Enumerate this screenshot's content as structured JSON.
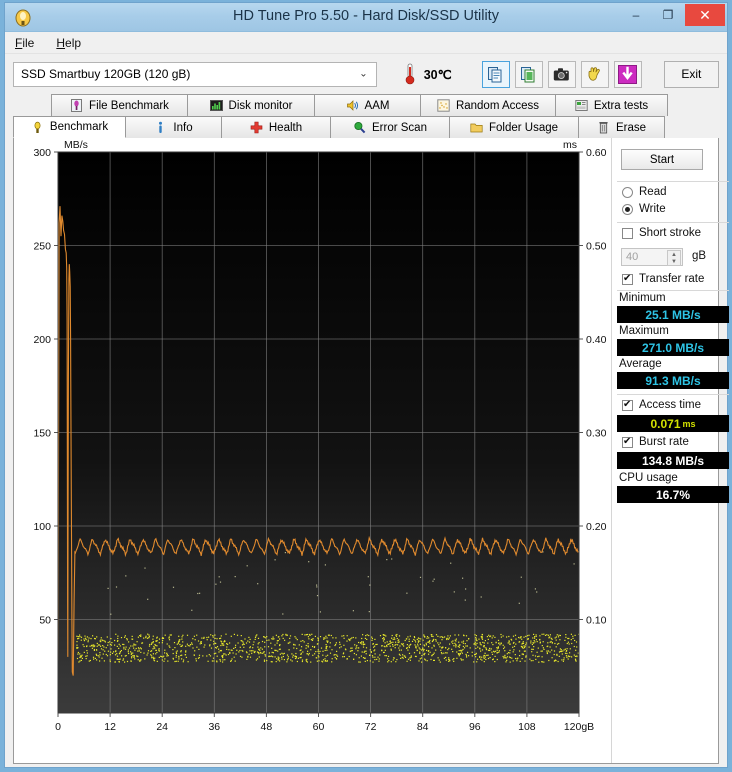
{
  "window": {
    "title": "HD Tune Pro 5.50 - Hard Disk/SSD Utility",
    "app_icon": "hdtune-icon",
    "minimize_label": "–",
    "maximize_label": "❐",
    "close_label": "✕",
    "accent_close": "#e8493f",
    "titlebar_color": "#a8cde9"
  },
  "menu": {
    "items": [
      "File",
      "Help"
    ]
  },
  "toolbar": {
    "drive": "SSD Smartbuy 120GB (120 gB)",
    "drive_placeholder": "Select drive",
    "dropdown_icon": "chevron-down-icon",
    "temperature": "30℃",
    "thermometer_icon": "thermometer-icon",
    "buttons": [
      {
        "name": "copy-icon",
        "selected": true
      },
      {
        "name": "copy-green-icon",
        "selected": false
      },
      {
        "name": "camera-icon",
        "selected": false
      },
      {
        "name": "hand-icon",
        "selected": false
      },
      {
        "name": "download-arrow-icon",
        "selected": false
      }
    ],
    "exit_label": "Exit"
  },
  "tabs": {
    "row1": [
      {
        "label": "File Benchmark",
        "icon": "file-benchmark-icon",
        "active": false
      },
      {
        "label": "Disk monitor",
        "icon": "disk-monitor-icon",
        "active": false
      },
      {
        "label": "AAM",
        "icon": "speaker-icon",
        "active": false
      },
      {
        "label": "Random Access",
        "icon": "random-access-icon",
        "active": false
      },
      {
        "label": "Extra tests",
        "icon": "extra-tests-icon",
        "active": false
      }
    ],
    "row2": [
      {
        "label": "Benchmark",
        "icon": "benchmark-icon",
        "active": true
      },
      {
        "label": "Info",
        "icon": "info-icon",
        "active": false
      },
      {
        "label": "Health",
        "icon": "health-cross-icon",
        "active": false
      },
      {
        "label": "Error Scan",
        "icon": "magnifier-icon",
        "active": false
      },
      {
        "label": "Folder Usage",
        "icon": "folder-icon",
        "active": false
      },
      {
        "label": "Erase",
        "icon": "trash-icon",
        "active": false
      }
    ]
  },
  "sidebar": {
    "start_label": "Start",
    "mode": {
      "read_label": "Read",
      "write_label": "Write",
      "selected": "Write"
    },
    "short_stroke": {
      "label": "Short stroke",
      "checked": false,
      "value": "40",
      "unit": "gB"
    },
    "transfer_rate": {
      "label": "Transfer rate",
      "checked": true
    },
    "minimum": {
      "label": "Minimum",
      "value": "25.1 MB/s",
      "color": "#2ec4e6"
    },
    "maximum": {
      "label": "Maximum",
      "value": "271.0 MB/s",
      "color": "#2ec4e6"
    },
    "average": {
      "label": "Average",
      "value": "91.3 MB/s",
      "color": "#2ec4e6"
    },
    "access_time": {
      "label": "Access time",
      "checked": true,
      "value": "0.071",
      "unit": "ms",
      "color": "#d2e000"
    },
    "burst_rate": {
      "label": "Burst rate",
      "checked": true,
      "value": "134.8 MB/s",
      "color": "#ffffff"
    },
    "cpu_usage": {
      "label": "CPU usage",
      "value": "16.7%",
      "color": "#ffffff"
    }
  },
  "chart_data": {
    "type": "line",
    "title": "",
    "xlabel": "gB",
    "ylabel": "MB/s",
    "y2label": "ms",
    "xlim": [
      0,
      120
    ],
    "ylim": [
      0,
      300
    ],
    "y2lim": [
      0,
      0.6
    ],
    "grid": true,
    "legend": "none",
    "xticks": [
      0,
      12,
      24,
      36,
      48,
      60,
      72,
      84,
      96,
      108,
      120
    ],
    "xticklabels": [
      "0",
      "12",
      "24",
      "36",
      "48",
      "60",
      "72",
      "84",
      "96",
      "108",
      "120gB"
    ],
    "yticks": [
      0,
      50,
      100,
      150,
      200,
      250,
      300
    ],
    "yticklabels": [
      "",
      "50",
      "100",
      "150",
      "200",
      "250",
      "300"
    ],
    "y2ticks": [
      0.1,
      0.2,
      0.3,
      0.4,
      0.5,
      0.6
    ],
    "y2ticklabels": [
      "0.10",
      "0.20",
      "0.30",
      "0.40",
      "0.50",
      "0.60"
    ],
    "plot_bg_top": "#000000",
    "plot_bg_bottom": "#3a3a3a",
    "grid_color": "#808080",
    "series": [
      {
        "name": "Transfer rate",
        "type": "line",
        "axis": "left",
        "color": "#e08a2e",
        "units": "MB/s",
        "points": [
          [
            0.0,
            28
          ],
          [
            0.25,
            262
          ],
          [
            0.45,
            271
          ],
          [
            0.7,
            255
          ],
          [
            0.9,
            266
          ],
          [
            1.1,
            263
          ],
          [
            1.3,
            258
          ],
          [
            1.5,
            256
          ],
          [
            1.7,
            248
          ],
          [
            1.9,
            246
          ],
          [
            2.0,
            238
          ],
          [
            2.1,
            210
          ],
          [
            2.15,
            150
          ],
          [
            2.2,
            60
          ],
          [
            2.25,
            30
          ],
          [
            2.3,
            86
          ],
          [
            2.4,
            180
          ],
          [
            2.5,
            232
          ],
          [
            2.6,
            240
          ],
          [
            2.7,
            236
          ],
          [
            2.8,
            228
          ],
          [
            2.9,
            200
          ],
          [
            3.0,
            150
          ],
          [
            3.1,
            95
          ],
          [
            3.2,
            50
          ],
          [
            3.3,
            22
          ],
          [
            3.5,
            20
          ],
          [
            3.7,
            60
          ],
          [
            3.9,
            86
          ],
          [
            4.1,
            90
          ],
          [
            4.4,
            87
          ],
          [
            4.8,
            93
          ],
          [
            5.2,
            86
          ],
          [
            5.6,
            92
          ],
          [
            6.0,
            85
          ],
          [
            6.5,
            93
          ],
          [
            7.0,
            86
          ],
          [
            7.5,
            92
          ],
          [
            8.0,
            85
          ],
          [
            8.5,
            93
          ],
          [
            9.0,
            86
          ],
          [
            9.5,
            92
          ],
          [
            10.0,
            85
          ],
          [
            10.5,
            93
          ],
          [
            11.0,
            86
          ],
          [
            12.0,
            92
          ],
          [
            13.0,
            86
          ],
          [
            14.0,
            93
          ],
          [
            15.0,
            85
          ],
          [
            16.0,
            92
          ],
          [
            17.0,
            86
          ],
          [
            18.0,
            93
          ],
          [
            19.0,
            85
          ],
          [
            20.0,
            92
          ],
          [
            21.0,
            86
          ],
          [
            22.0,
            93
          ],
          [
            23.0,
            85
          ],
          [
            24.0,
            92
          ],
          [
            25.0,
            86
          ],
          [
            26.0,
            93
          ],
          [
            27.0,
            85
          ],
          [
            28.0,
            92
          ],
          [
            29.0,
            86
          ],
          [
            30.0,
            93
          ],
          [
            31.0,
            85
          ],
          [
            32.0,
            92
          ],
          [
            33.0,
            86
          ],
          [
            34.0,
            93
          ],
          [
            35.0,
            85
          ],
          [
            36.0,
            92
          ],
          [
            38.0,
            86
          ],
          [
            40.0,
            93
          ],
          [
            42.0,
            85
          ],
          [
            44.0,
            92
          ],
          [
            46.0,
            86
          ],
          [
            48.0,
            93
          ],
          [
            50.0,
            85
          ],
          [
            52.0,
            92
          ],
          [
            54.0,
            86
          ],
          [
            56.0,
            93
          ],
          [
            58.0,
            85
          ],
          [
            60.0,
            92
          ],
          [
            62.0,
            86
          ],
          [
            64.0,
            93
          ],
          [
            66.0,
            85
          ],
          [
            68.0,
            92
          ],
          [
            70.0,
            86
          ],
          [
            72.0,
            93
          ],
          [
            74.0,
            85
          ],
          [
            76.0,
            92
          ],
          [
            78.0,
            86
          ],
          [
            80.0,
            93
          ],
          [
            82.0,
            85
          ],
          [
            84.0,
            92
          ],
          [
            86.0,
            86
          ],
          [
            88.0,
            93
          ],
          [
            90.0,
            85
          ],
          [
            92.0,
            92
          ],
          [
            94.0,
            86
          ],
          [
            96.0,
            93
          ],
          [
            98.0,
            85
          ],
          [
            100.0,
            92
          ],
          [
            102.0,
            86
          ],
          [
            104.0,
            93
          ],
          [
            106.0,
            85
          ],
          [
            108.0,
            92
          ],
          [
            110.0,
            86
          ],
          [
            112.0,
            93
          ],
          [
            114.0,
            85
          ],
          [
            116.0,
            92
          ],
          [
            118.0,
            87
          ],
          [
            120.0,
            89
          ]
        ],
        "summary": {
          "minimum_mbs": 25.1,
          "maximum_mbs": 271.0,
          "average_mbs": 91.3,
          "plateau_mean_mbs": 89,
          "plateau_range_mbs": [
            85,
            93
          ]
        }
      },
      {
        "name": "Access time",
        "type": "scatter",
        "axis": "right",
        "color": "#e8e82a",
        "units": "ms",
        "mean_ms": 0.071,
        "band_ms": [
          0.055,
          0.085
        ],
        "outlier_ms": [
          0.105,
          0.118,
          0.128,
          0.132,
          0.145,
          0.158
        ]
      }
    ]
  }
}
